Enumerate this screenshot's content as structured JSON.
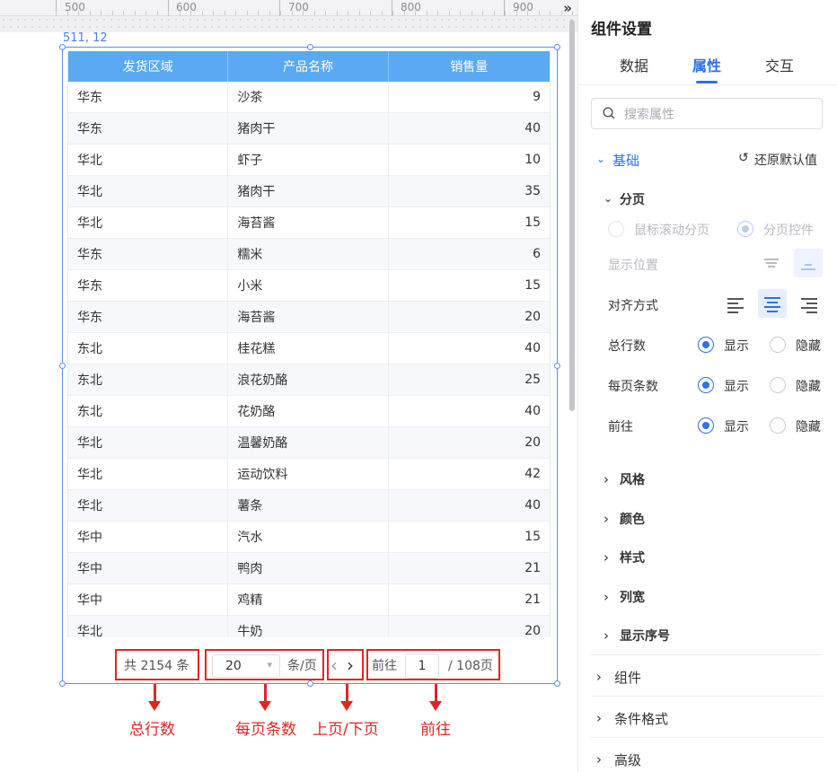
{
  "ruler": {
    "labels": [
      "500",
      "600",
      "700",
      "800",
      "900"
    ],
    "more": "»"
  },
  "selection": {
    "coord": "511, 12"
  },
  "table": {
    "headers": [
      "发货区域",
      "产品名称",
      "销售量"
    ],
    "rows": [
      [
        "华东",
        "沙茶",
        "9"
      ],
      [
        "华东",
        "猪肉干",
        "40"
      ],
      [
        "华北",
        "虾子",
        "10"
      ],
      [
        "华北",
        "猪肉干",
        "35"
      ],
      [
        "华北",
        "海苔酱",
        "15"
      ],
      [
        "华东",
        "糯米",
        "6"
      ],
      [
        "华东",
        "小米",
        "15"
      ],
      [
        "华东",
        "海苔酱",
        "20"
      ],
      [
        "东北",
        "桂花糕",
        "40"
      ],
      [
        "东北",
        "浪花奶酪",
        "25"
      ],
      [
        "东北",
        "花奶酪",
        "40"
      ],
      [
        "华北",
        "温馨奶酪",
        "20"
      ],
      [
        "华北",
        "运动饮料",
        "42"
      ],
      [
        "华北",
        "薯条",
        "40"
      ],
      [
        "华中",
        "汽水",
        "15"
      ],
      [
        "华中",
        "鸭肉",
        "21"
      ],
      [
        "华中",
        "鸡精",
        "21"
      ],
      [
        "华北",
        "牛奶",
        "20"
      ]
    ],
    "header_color": "#5aa9f2"
  },
  "pager": {
    "total": "共 2154 条",
    "page_size": "20",
    "page_size_unit": "条/页",
    "prev": "‹",
    "next": "›",
    "goto_label": "前往",
    "goto_value": "1",
    "total_pages": "/ 108页"
  },
  "annotations": {
    "total": "总行数",
    "page_size": "每页条数",
    "prev_next": "上页/下页",
    "goto": "前往",
    "color": "#e02525"
  },
  "panel": {
    "title": "组件设置",
    "tabs": [
      "数据",
      "属性",
      "交互"
    ],
    "active_tab": "属性",
    "search_placeholder": "搜索属性",
    "basic": "基础",
    "reset": "还原默认值",
    "paging": "分页",
    "mode_scroll": "鼠标滚动分页",
    "mode_control": "分页控件",
    "position_label": "显示位置",
    "align_label": "对齐方式",
    "total_rows_label": "总行数",
    "page_size_label": "每页条数",
    "goto_label": "前往",
    "show": "显示",
    "hide": "隐藏",
    "subsections": [
      "风格",
      "颜色",
      "样式",
      "列宽",
      "显示序号"
    ],
    "sections": [
      "组件",
      "条件格式",
      "高级"
    ],
    "accent": "#2f6fe8"
  }
}
